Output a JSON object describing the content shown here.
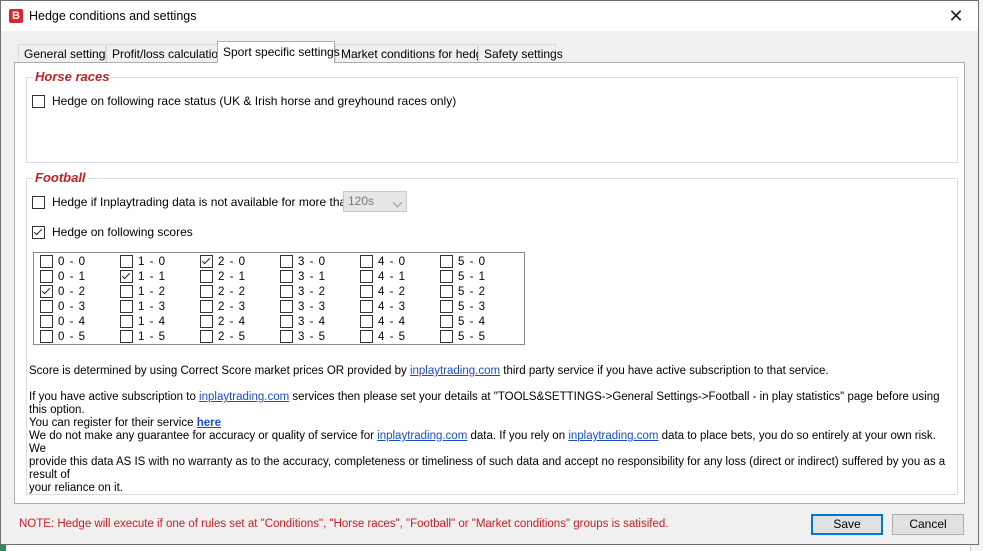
{
  "window": {
    "title": "Hedge conditions and settings",
    "icon_letter": "B",
    "close_glyph": "✕"
  },
  "tabs": [
    {
      "label": "General settings",
      "active": false
    },
    {
      "label": "Profit/loss calculation",
      "active": false
    },
    {
      "label": "Sport specific settings",
      "active": true
    },
    {
      "label": "Market conditions for hedge",
      "active": false
    },
    {
      "label": "Safety settings",
      "active": false
    }
  ],
  "horse_races": {
    "title": "Horse races",
    "race_status_label": "Hedge on following race status (UK & Irish horse and greyhound races only)",
    "race_status_checked": false
  },
  "football": {
    "title": "Football",
    "inplay_unavailable_label": "Hedge if Inplaytrading data is not available for more than",
    "inplay_unavailable_checked": false,
    "timeout_value": "120s",
    "scores_label": "Hedge on following scores",
    "scores_checked": true,
    "scores": [
      {
        "label": "0 - 0",
        "checked": false
      },
      {
        "label": "0 - 1",
        "checked": false
      },
      {
        "label": "0 - 2",
        "checked": true
      },
      {
        "label": "0 - 3",
        "checked": false
      },
      {
        "label": "0 - 4",
        "checked": false
      },
      {
        "label": "0 - 5",
        "checked": false
      },
      {
        "label": "1 - 0",
        "checked": false
      },
      {
        "label": "1 - 1",
        "checked": true
      },
      {
        "label": "1 - 2",
        "checked": false
      },
      {
        "label": "1 - 3",
        "checked": false
      },
      {
        "label": "1 - 4",
        "checked": false
      },
      {
        "label": "1 - 5",
        "checked": false
      },
      {
        "label": "2 - 0",
        "checked": true
      },
      {
        "label": "2 - 1",
        "checked": false
      },
      {
        "label": "2 - 2",
        "checked": false
      },
      {
        "label": "2 - 3",
        "checked": false
      },
      {
        "label": "2 - 4",
        "checked": false
      },
      {
        "label": "2 - 5",
        "checked": false
      },
      {
        "label": "3 - 0",
        "checked": false
      },
      {
        "label": "3 - 1",
        "checked": false
      },
      {
        "label": "3 - 2",
        "checked": false
      },
      {
        "label": "3 - 3",
        "checked": false
      },
      {
        "label": "3 - 4",
        "checked": false
      },
      {
        "label": "3 - 5",
        "checked": false
      },
      {
        "label": "4 - 0",
        "checked": false
      },
      {
        "label": "4 - 1",
        "checked": false
      },
      {
        "label": "4 - 2",
        "checked": false
      },
      {
        "label": "4 - 3",
        "checked": false
      },
      {
        "label": "4 - 4",
        "checked": false
      },
      {
        "label": "4 - 5",
        "checked": false
      },
      {
        "label": "5 - 0",
        "checked": false
      },
      {
        "label": "5 - 1",
        "checked": false
      },
      {
        "label": "5 - 2",
        "checked": false
      },
      {
        "label": "5 - 3",
        "checked": false
      },
      {
        "label": "5 - 4",
        "checked": false
      },
      {
        "label": "5 - 5",
        "checked": false
      }
    ],
    "info1_prefix": "Score is determined by using Correct Score market prices OR provided by ",
    "info1_link": "inplaytrading.com",
    "info1_suffix": " third party service if you have active subscription to that service.",
    "info2_prefix": "If you have active subscription to ",
    "info2_link": "inplaytrading.com",
    "info2_suffix": " services then please set your details at \"TOOLS&SETTINGS->General Settings->Football - in play statistics\" page before using this option.",
    "info2b_prefix": "You can register for their service ",
    "info2b_link": "here",
    "disclaimer_prefix": "We do not make any guarantee for accuracy or quality of service for ",
    "disclaimer_link1": "inplaytrading.com",
    "disclaimer_mid": " data. If you rely on ",
    "disclaimer_link2": "inplaytrading.com",
    "disclaimer_suffix1": " data to place bets, you do so entirely at your own risk. We",
    "disclaimer_line2": "provide this data AS IS with no warranty as to the accuracy, completeness or timeliness of such data and accept no responsibility for any loss (direct or indirect) suffered by you as a result of",
    "disclaimer_line3": "your reliance on it."
  },
  "footer": {
    "note": "NOTE: Hedge will execute if one of rules set at \"Conditions\", \"Horse races\", \"Football\" or \"Market conditions\" groups is satisifed.",
    "save_label": "Save",
    "cancel_label": "Cancel"
  },
  "colors": {
    "accent_red": "#c42026",
    "link_blue": "#1a4ec7",
    "primary_border": "#0078d7"
  }
}
